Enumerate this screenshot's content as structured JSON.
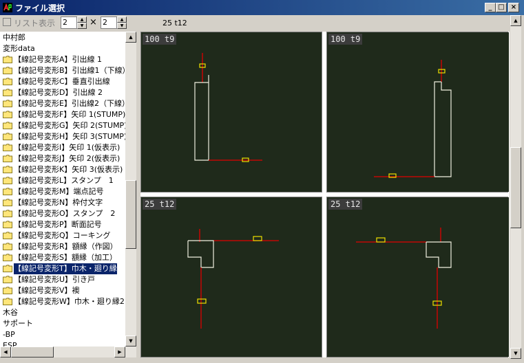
{
  "window": {
    "title": "ファイル選択",
    "buttons": {
      "minimize": "_",
      "maximize": "□",
      "close": "×"
    }
  },
  "toolbar": {
    "list_checkbox_label": "リスト表示",
    "list_checked": false,
    "cols_value": "2",
    "times": "×",
    "rows_value": "2",
    "status": "25 t12"
  },
  "tree": {
    "items": [
      {
        "label": "中村郎",
        "type": "text"
      },
      {
        "label": "変形data",
        "type": "text"
      },
      {
        "label": "【線記号変形A】引出線 1",
        "type": "folder"
      },
      {
        "label": "【線記号変形B】引出線1（下線）",
        "type": "folder"
      },
      {
        "label": "【線記号変形C】垂直引出線",
        "type": "folder"
      },
      {
        "label": "【線記号変形D】引出線 2",
        "type": "folder"
      },
      {
        "label": "【線記号変形E】引出線2（下線）",
        "type": "folder"
      },
      {
        "label": "【線記号変形F】矢印 1(STUMP)",
        "type": "folder"
      },
      {
        "label": "【線記号変形G】矢印 2(STUMP)",
        "type": "folder"
      },
      {
        "label": "【線記号変形H】矢印 3(STUMP)",
        "type": "folder"
      },
      {
        "label": "【線記号変形I】矢印 1(仮表示)",
        "type": "folder"
      },
      {
        "label": "【線記号変形J】矢印 2(仮表示)",
        "type": "folder"
      },
      {
        "label": "【線記号変形K】矢印 3(仮表示)",
        "type": "folder"
      },
      {
        "label": "【線記号変形L】スタンプ　1",
        "type": "folder"
      },
      {
        "label": "【線記号変形M】端点記号",
        "type": "folder"
      },
      {
        "label": "【線記号変形N】枠付文字",
        "type": "folder"
      },
      {
        "label": "【線記号変形O】スタンプ　2",
        "type": "folder"
      },
      {
        "label": "【線記号変形P】断面記号",
        "type": "folder"
      },
      {
        "label": "【線記号変形Q】コーキング",
        "type": "folder"
      },
      {
        "label": "【線記号変形R】額縁（作図）",
        "type": "folder"
      },
      {
        "label": "【線記号変形S】額縁（加工）",
        "type": "folder"
      },
      {
        "label": "【線記号変形T】巾木・廻り縁",
        "type": "folder",
        "selected": true
      },
      {
        "label": "【線記号変形U】引き戸",
        "type": "folder"
      },
      {
        "label": "【線記号変形V】襖",
        "type": "folder"
      },
      {
        "label": "【線記号変形W】巾木・廻り縁2",
        "type": "folder"
      },
      {
        "label": "木谷",
        "type": "text"
      },
      {
        "label": "サポート",
        "type": "text"
      },
      {
        "label": "-BP",
        "type": "text"
      },
      {
        "label": "ESP",
        "type": "text"
      }
    ]
  },
  "preview": {
    "panes": [
      {
        "label": "100 t9",
        "selected": false
      },
      {
        "label": "100 t9",
        "selected": false
      },
      {
        "label": "25 t12",
        "selected": false
      },
      {
        "label": "25 t12",
        "selected": false
      }
    ]
  },
  "colors": {
    "pane_bg": "#1f2a1b",
    "shape_line": "#f0f0e0",
    "leader_line": "#e00000",
    "marker": "#f0e000",
    "selection": "#0a246a",
    "titlebar": "#0a246a"
  }
}
